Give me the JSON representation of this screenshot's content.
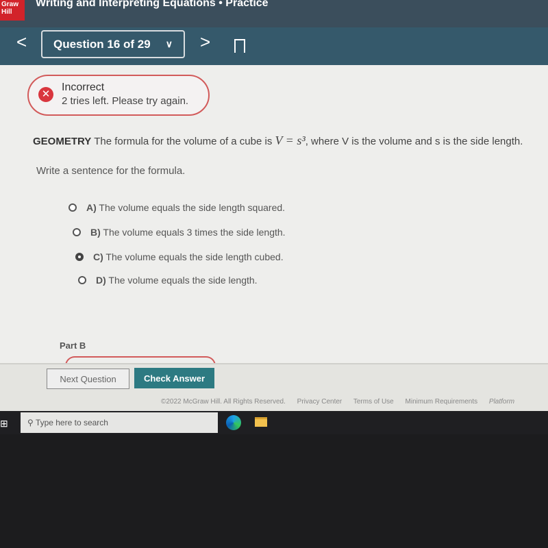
{
  "header": {
    "logo": "Graw Hill",
    "title": "Writing and Interpreting Equations • Practice"
  },
  "nav": {
    "question": "Question 16 of 29",
    "prev": "<",
    "next": ">"
  },
  "alert": {
    "title": "Incorrect",
    "message": "2 tries left. Please try again."
  },
  "question": {
    "subject": "GEOMETRY",
    "text1": "The formula for the volume of a cube is ",
    "formula": "V = s³",
    "text2": ", where V is the volume and s is the side length.",
    "prompt": "Write a sentence for the formula."
  },
  "options": [
    {
      "letter": "A)",
      "text": "The volume equals the side length squared.",
      "selected": false
    },
    {
      "letter": "B)",
      "text": "The volume equals 3 times the side length.",
      "selected": false
    },
    {
      "letter": "C)",
      "text": "The volume equals the side length cubed.",
      "selected": true
    },
    {
      "letter": "D)",
      "text": "The volume equals the side length.",
      "selected": false
    }
  ],
  "part_b": "Part B",
  "buttons": {
    "next": "Next Question",
    "check": "Check Answer"
  },
  "footer": [
    "©2022 McGraw Hill. All Rights Reserved.",
    "Privacy Center",
    "Terms of Use",
    "Minimum Requirements",
    "Platform"
  ],
  "taskbar": {
    "search_placeholder": "Type here to search"
  }
}
